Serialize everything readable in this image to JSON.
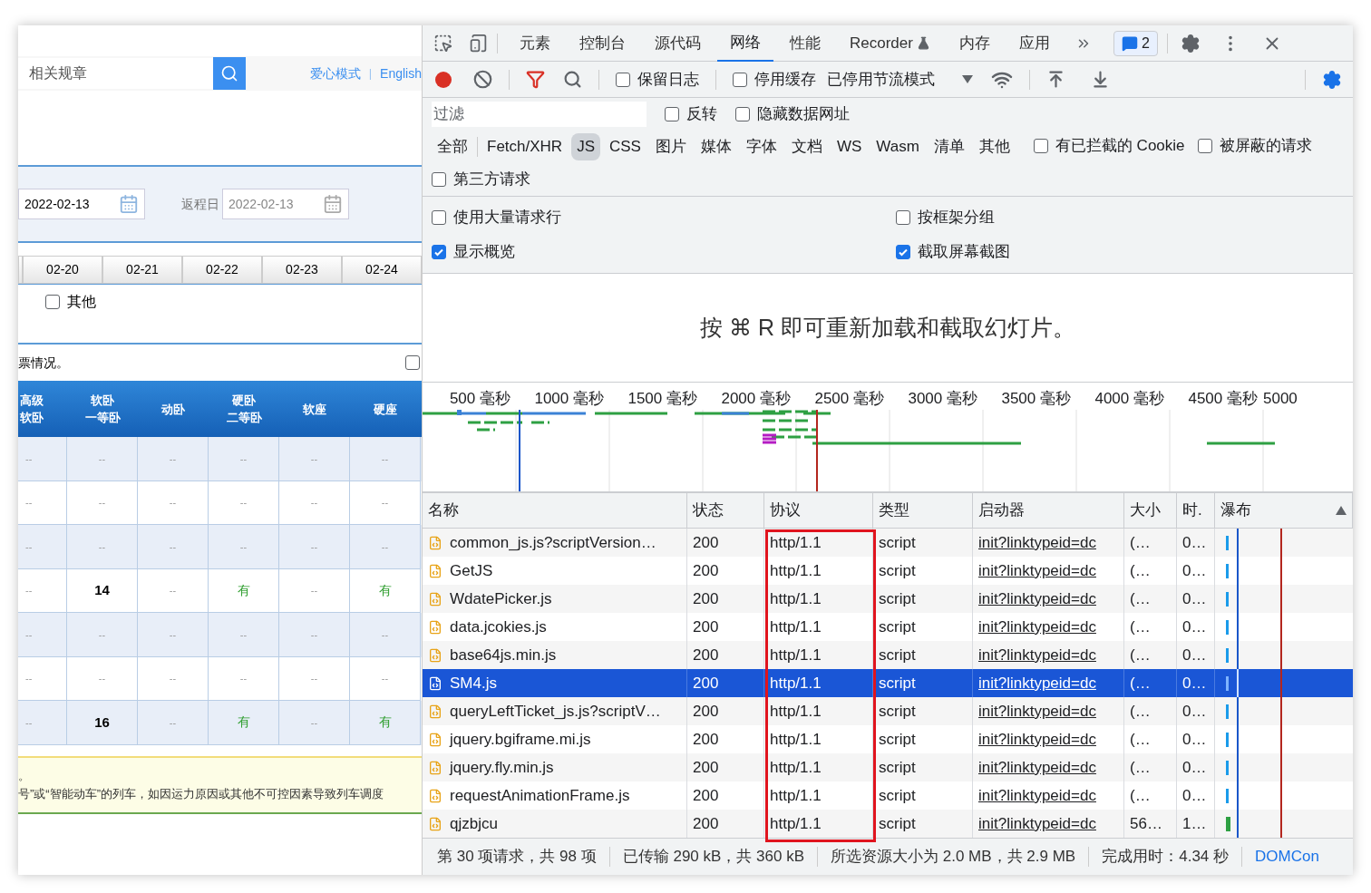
{
  "page": {
    "search": {
      "placeholder": "相关规章"
    },
    "links": [
      "爱心模式",
      "English"
    ],
    "link_separator": "|",
    "depart_date": "2022-02-13",
    "return_label": "返程日",
    "return_date": "2022-02-13",
    "date_tabs": [
      "02-20",
      "02-21",
      "02-22",
      "02-23",
      "02-24"
    ],
    "filter_checkbox": {
      "label": "其他",
      "checked": false
    },
    "ticket_note": "票情况。",
    "note_checkbox": {
      "checked": false
    },
    "seat_table": {
      "columns": [
        {
          "label": "高级",
          "sublabel": "软卧"
        },
        {
          "label": "软卧",
          "sublabel": "一等卧"
        },
        {
          "label": "动卧"
        },
        {
          "label": "硬卧",
          "sublabel": "二等卧"
        },
        {
          "label": "软座"
        },
        {
          "label": "硬座"
        }
      ],
      "rows": [
        [
          {
            "text": "--",
            "kind": "none"
          },
          {
            "text": "--",
            "kind": "none"
          },
          {
            "text": "--",
            "kind": "none"
          },
          {
            "text": "--",
            "kind": "none"
          },
          {
            "text": "--",
            "kind": "none"
          },
          {
            "text": "--",
            "kind": "none"
          }
        ],
        [
          {
            "text": "--",
            "kind": "none"
          },
          {
            "text": "--",
            "kind": "none"
          },
          {
            "text": "--",
            "kind": "none"
          },
          {
            "text": "--",
            "kind": "none"
          },
          {
            "text": "--",
            "kind": "none"
          },
          {
            "text": "--",
            "kind": "none"
          }
        ],
        [
          {
            "text": "--",
            "kind": "none"
          },
          {
            "text": "--",
            "kind": "none"
          },
          {
            "text": "--",
            "kind": "none"
          },
          {
            "text": "--",
            "kind": "none"
          },
          {
            "text": "--",
            "kind": "none"
          },
          {
            "text": "--",
            "kind": "none"
          }
        ],
        [
          {
            "text": "--",
            "kind": "none"
          },
          {
            "text": "14",
            "kind": "count"
          },
          {
            "text": "--",
            "kind": "none"
          },
          {
            "text": "有",
            "kind": "available"
          },
          {
            "text": "--",
            "kind": "none"
          },
          {
            "text": "有",
            "kind": "available"
          }
        ],
        [
          {
            "text": "--",
            "kind": "none"
          },
          {
            "text": "--",
            "kind": "none"
          },
          {
            "text": "--",
            "kind": "none"
          },
          {
            "text": "--",
            "kind": "none"
          },
          {
            "text": "--",
            "kind": "none"
          },
          {
            "text": "--",
            "kind": "none"
          }
        ],
        [
          {
            "text": "--",
            "kind": "none"
          },
          {
            "text": "--",
            "kind": "none"
          },
          {
            "text": "--",
            "kind": "none"
          },
          {
            "text": "--",
            "kind": "none"
          },
          {
            "text": "--",
            "kind": "none"
          },
          {
            "text": "--",
            "kind": "none"
          }
        ],
        [
          {
            "text": "--",
            "kind": "none"
          },
          {
            "text": "16",
            "kind": "count"
          },
          {
            "text": "--",
            "kind": "none"
          },
          {
            "text": "有",
            "kind": "available"
          },
          {
            "text": "--",
            "kind": "none"
          },
          {
            "text": "有",
            "kind": "available"
          }
        ]
      ]
    },
    "notice": [
      "。",
      "号”或“智能动车”的列车，如因运力原因或其他不可控因素导致列车调度"
    ]
  },
  "devtools": {
    "tabs": [
      {
        "label": "元素",
        "selected": false,
        "kind": "plain"
      },
      {
        "label": "控制台",
        "selected": false,
        "kind": "plain"
      },
      {
        "label": "源代码",
        "selected": false,
        "kind": "plain"
      },
      {
        "label": "网络",
        "selected": true,
        "kind": "plain"
      },
      {
        "label": "性能",
        "selected": false,
        "kind": "plain"
      },
      {
        "label": "Recorder",
        "selected": false,
        "kind": "experimental"
      },
      {
        "label": "内存",
        "selected": false,
        "kind": "plain"
      },
      {
        "label": "应用",
        "selected": false,
        "kind": "plain"
      }
    ],
    "issues_count": "2",
    "toolbar": {
      "recording": true,
      "filter_active": true,
      "checkboxes": [
        {
          "label": "保留日志",
          "checked": false
        },
        {
          "label": "停用缓存",
          "checked": false
        }
      ],
      "throttling": "已停用节流模式"
    },
    "filter": {
      "placeholder": "过滤",
      "checkboxes": [
        {
          "label": "反转",
          "checked": false
        },
        {
          "label": "隐藏数据网址",
          "checked": false
        }
      ]
    },
    "types": [
      {
        "label": "全部",
        "selected": false
      },
      {
        "label": "Fetch/XHR",
        "selected": false
      },
      {
        "label": "JS",
        "selected": true
      },
      {
        "label": "CSS",
        "selected": false
      },
      {
        "label": "图片",
        "selected": false
      },
      {
        "label": "媒体",
        "selected": false
      },
      {
        "label": "字体",
        "selected": false
      },
      {
        "label": "文档",
        "selected": false
      },
      {
        "label": "WS",
        "selected": false
      },
      {
        "label": "Wasm",
        "selected": false
      },
      {
        "label": "清单",
        "selected": false
      },
      {
        "label": "其他",
        "selected": false
      }
    ],
    "type_checkboxes": [
      {
        "label": "有已拦截的 Cookie",
        "checked": false
      },
      {
        "label": "被屏蔽的请求",
        "checked": false
      },
      {
        "label": "第三方请求",
        "checked": false
      }
    ],
    "options": [
      {
        "label": "使用大量请求行",
        "checked": false
      },
      {
        "label": "按框架分组",
        "checked": false
      },
      {
        "label": "显示概览",
        "checked": true
      },
      {
        "label": "截取屏幕截图",
        "checked": true
      }
    ],
    "screenshot_hint": "按 ⌘ R 即可重新加载和截取幻灯片。",
    "timeline_ticks": [
      "500 毫秒",
      "1000 毫秒",
      "1500 毫秒",
      "2000 毫秒",
      "2500 毫秒",
      "3000 毫秒",
      "3500 毫秒",
      "4000 毫秒",
      "4500 毫秒",
      "5000"
    ],
    "table": {
      "columns": [
        "名称",
        "状态",
        "协议",
        "类型",
        "启动器",
        "大小",
        "时.",
        "瀑布"
      ],
      "rows": [
        {
          "name": "common_js.js?scriptVersion…",
          "status": "200",
          "protocol": "http/1.1",
          "type": "script",
          "initiator": "init?linktypeid=dc",
          "size": "(…",
          "time": "0…",
          "selected": false
        },
        {
          "name": "GetJS",
          "status": "200",
          "protocol": "http/1.1",
          "type": "script",
          "initiator": "init?linktypeid=dc",
          "size": "(…",
          "time": "0…",
          "selected": false
        },
        {
          "name": "WdatePicker.js",
          "status": "200",
          "protocol": "http/1.1",
          "type": "script",
          "initiator": "init?linktypeid=dc",
          "size": "(…",
          "time": "0…",
          "selected": false
        },
        {
          "name": "data.jcokies.js",
          "status": "200",
          "protocol": "http/1.1",
          "type": "script",
          "initiator": "init?linktypeid=dc",
          "size": "(…",
          "time": "0…",
          "selected": false
        },
        {
          "name": "base64js.min.js",
          "status": "200",
          "protocol": "http/1.1",
          "type": "script",
          "initiator": "init?linktypeid=dc",
          "size": "(…",
          "time": "0…",
          "selected": false
        },
        {
          "name": "SM4.js",
          "status": "200",
          "protocol": "http/1.1",
          "type": "script",
          "initiator": "init?linktypeid=dc",
          "size": "(…",
          "time": "0…",
          "selected": true
        },
        {
          "name": "queryLeftTicket_js.js?scriptV…",
          "status": "200",
          "protocol": "http/1.1",
          "type": "script",
          "initiator": "init?linktypeid=dc",
          "size": "(…",
          "time": "0…",
          "selected": false
        },
        {
          "name": "jquery.bgiframe.mi.js",
          "status": "200",
          "protocol": "http/1.1",
          "type": "script",
          "initiator": "init?linktypeid=dc",
          "size": "(…",
          "time": "0…",
          "selected": false
        },
        {
          "name": "jquery.fly.min.js",
          "status": "200",
          "protocol": "http/1.1",
          "type": "script",
          "initiator": "init?linktypeid=dc",
          "size": "(…",
          "time": "0…",
          "selected": false
        },
        {
          "name": "requestAnimationFrame.js",
          "status": "200",
          "protocol": "http/1.1",
          "type": "script",
          "initiator": "init?linktypeid=dc",
          "size": "(…",
          "time": "0…",
          "selected": false
        },
        {
          "name": "qjzbjcu",
          "status": "200",
          "protocol": "http/1.1",
          "type": "script",
          "initiator": "init?linktypeid=dc",
          "size": "56…",
          "time": "1…",
          "selected": false
        }
      ]
    },
    "status_bar": [
      "第 30 项请求，共 98 项",
      "已传输 290 kB，共 360 kB",
      "所选资源大小为 2.0 MB，共 2.9 MB",
      "完成用时：4.34 秒",
      "DOMCon"
    ]
  }
}
